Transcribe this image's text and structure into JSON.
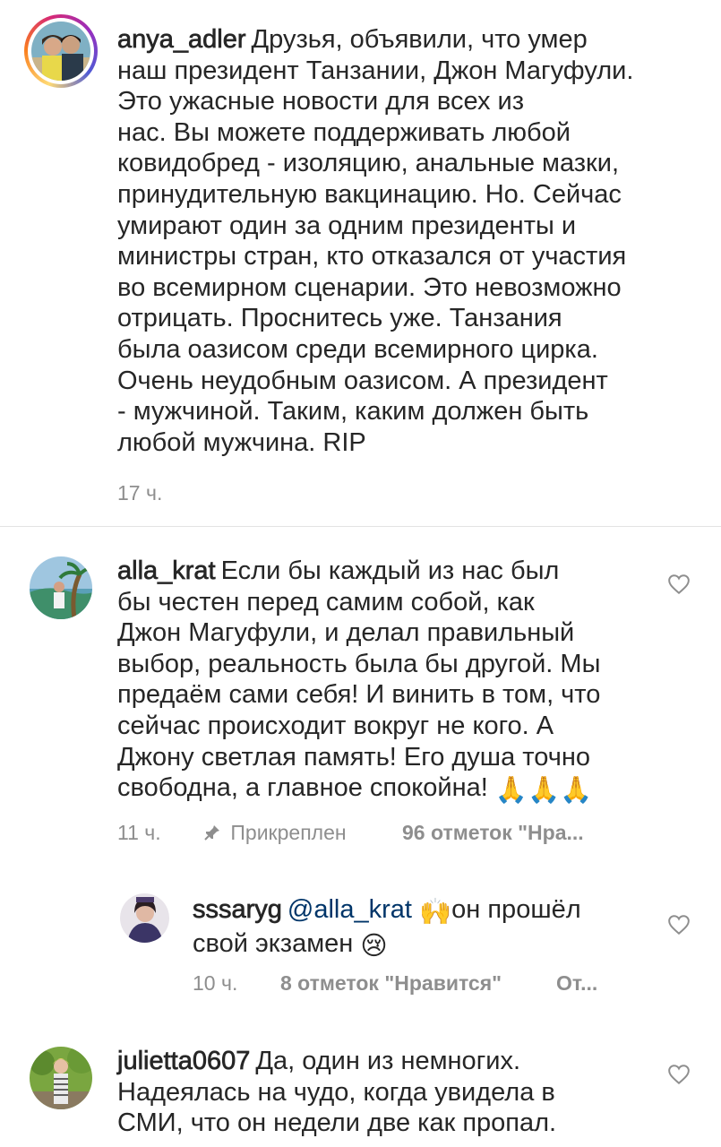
{
  "comments": [
    {
      "username": "anya_adler",
      "text": "Друзья, объявили, что умер\nнаш президент Танзании, Джон Магуфули.\nЭто ужасные новости для всех из\nнас. Вы можете поддерживать любой\nковидобред - изоляцию, анальные мазки,\nпринудительную вакцинацию. Но. Сейчас\nумирают один за одним президенты и\nминистры стран, кто отказался от участия\nво всемирном сценарии. Это невозможно\nотрицать. Проснитесь уже. Танзания\nбыла оазисом среди всемирного цирка.\nОчень неудобным оазисом. А президент\n- мужчиной. Таким, каким должен быть\nлюбой мужчина. RIP",
      "time": "17 ч."
    },
    {
      "username": "alla_krat",
      "text": "Если бы каждый из нас был\nбы честен перед самим собой, как\nДжон Магуфули, и делал правильный\nвыбор, реальность была бы другой.  Мы\nпредаём сами себя! И винить в том, что\nсейчас происходит вокруг не кого. А\nДжону светлая память! Его душа точно\nсвободна, а главное спокойна! ",
      "emoji": "🙏🙏🙏",
      "time": "11 ч.",
      "pinned": "Прикреплен",
      "likes": "96 отметок \"Нра..."
    },
    {
      "username": "sssaryg",
      "mention": "@alla_krat",
      "text_after_emoji": "он прошёл\nсвой экзамен ",
      "emoji_hands": "🙌",
      "emoji_face": "😢",
      "time": "10 ч.",
      "likes": "8 отметок \"Нравится\"",
      "reply": "От..."
    },
    {
      "username": "julietta0607",
      "text": "Да, один из немногих.\nНадеялась на чудо, когда увидела в\nСМИ, что он недели две как пропал.",
      "time": ""
    }
  ],
  "icons": {
    "heart": "heart-outline-icon",
    "pin": "pin-icon"
  },
  "colors": {
    "text": "#262626",
    "meta": "#8e8e8e",
    "mention": "#003569",
    "divider": "#e3e3e3"
  }
}
